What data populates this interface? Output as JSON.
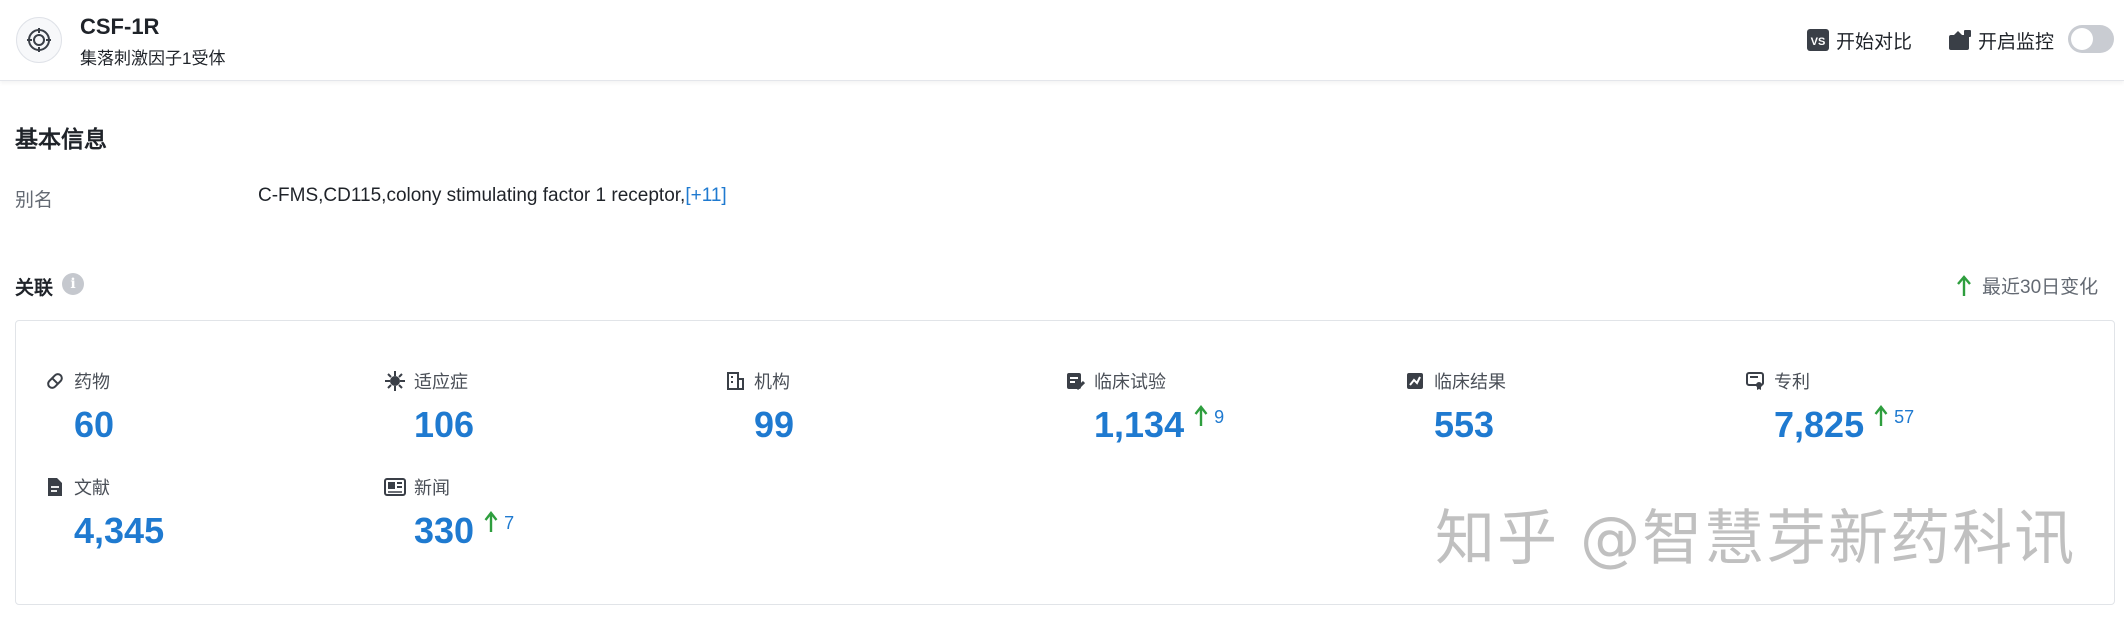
{
  "header": {
    "title": "CSF-1R",
    "subtitle": "集落刺激因子1受体",
    "compare_label": "开始对比",
    "monitor_label": "开启监控",
    "monitor_on": false,
    "icons": {
      "target": "target-icon",
      "compare": "vs-icon",
      "monitor": "monitor-icon"
    }
  },
  "basic_info": {
    "title": "基本信息",
    "alias_label": "别名",
    "alias_value": "C-FMS,CD115,colony stimulating factor 1 receptor,",
    "alias_more": "[+11]"
  },
  "related": {
    "title": "关联",
    "recent_label": "最近30日变化",
    "colors": {
      "accent": "#1f7ad0",
      "up": "#2e9e3e"
    },
    "stats": [
      {
        "key": "drugs",
        "label": "药物",
        "value": "60",
        "change": "",
        "icon": "pill-icon"
      },
      {
        "key": "indications",
        "label": "适应症",
        "value": "106",
        "change": "",
        "icon": "virus-icon"
      },
      {
        "key": "organizations",
        "label": "机构",
        "value": "99",
        "change": "",
        "icon": "building-icon"
      },
      {
        "key": "clinical_trials",
        "label": "临床试验",
        "value": "1,134",
        "change": "9",
        "icon": "trial-icon"
      },
      {
        "key": "clinical_results",
        "label": "临床结果",
        "value": "553",
        "change": "",
        "icon": "results-icon"
      },
      {
        "key": "patents",
        "label": "专利",
        "value": "7,825",
        "change": "57",
        "icon": "patent-icon"
      },
      {
        "key": "literature",
        "label": "文献",
        "value": "4,345",
        "change": "",
        "icon": "document-icon"
      },
      {
        "key": "news",
        "label": "新闻",
        "value": "330",
        "change": "7",
        "icon": "news-icon"
      }
    ]
  },
  "watermark": "知乎 @智慧芽新药科讯"
}
